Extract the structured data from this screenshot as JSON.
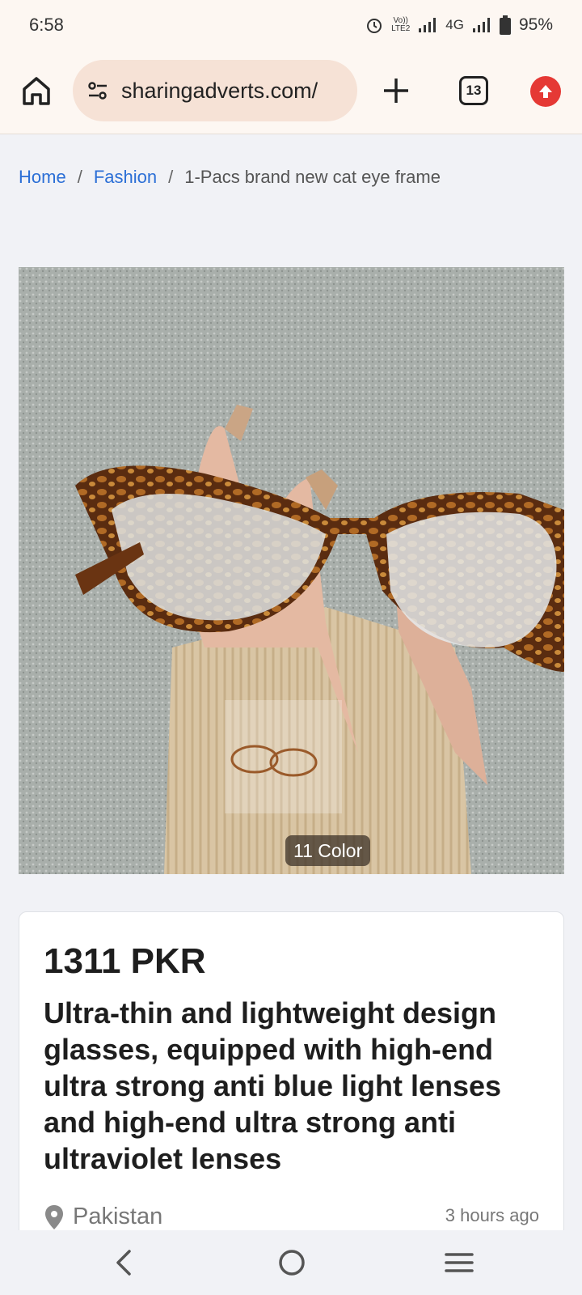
{
  "status": {
    "time": "6:58",
    "network": "4G",
    "battery": "95%",
    "volte_top": "Vo))",
    "volte_bottom": "LTE2"
  },
  "browser": {
    "url": "sharingadverts.com/",
    "tab_count": "13"
  },
  "breadcrumb": {
    "home": "Home",
    "category": "Fashion",
    "current": "1-Pacs brand new cat eye frame"
  },
  "listing": {
    "image_badge": "11 Color",
    "price": "1311 PKR",
    "title": "Ultra-thin and lightweight design glasses, equipped with high-end ultra strong anti blue light lenses and high-end ultra strong anti ultraviolet lenses",
    "location": "Pakistan",
    "posted": "3 hours ago"
  },
  "colors": {
    "link": "#2b6fd6",
    "update_badge": "#e53935",
    "url_pill": "#f6e2d6"
  }
}
